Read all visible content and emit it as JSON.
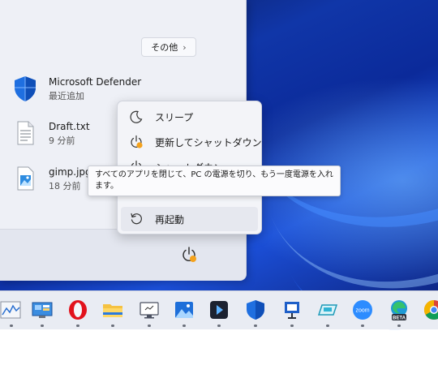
{
  "start_menu": {
    "more_label": "その他",
    "more_chevron": "›",
    "recommended": [
      {
        "name": "Microsoft Defender",
        "detail": "最近追加",
        "icon": "defender-shield-icon"
      },
      {
        "name": "Draft.txt",
        "detail": "9 分前",
        "icon": "text-file-icon"
      },
      {
        "name": "gimp.jpg",
        "detail": "18 分前",
        "icon": "image-file-icon"
      }
    ],
    "power_icon": "power-icon"
  },
  "power_menu": {
    "items": [
      {
        "label": "スリープ",
        "icon": "moon-icon"
      },
      {
        "label": "更新してシャットダウン",
        "icon": "update-shutdown-icon"
      },
      {
        "label": "シャットダウン",
        "icon": "power-icon"
      },
      {
        "label": "再起動",
        "icon": "restart-icon"
      }
    ]
  },
  "tooltip": {
    "text": "すべてのアプリを閉じて、PC の電源を切り、もう一度電源を入れます。"
  },
  "taskbar": {
    "apps": [
      {
        "name": "chart-app-icon"
      },
      {
        "name": "control-panel-icon"
      },
      {
        "name": "opera-browser-icon"
      },
      {
        "name": "file-explorer-icon"
      },
      {
        "name": "monitor-app-icon"
      },
      {
        "name": "photos-app-icon"
      },
      {
        "name": "media-app-icon"
      },
      {
        "name": "defender-app-icon"
      },
      {
        "name": "presentation-app-icon"
      },
      {
        "name": "remote-app-icon"
      },
      {
        "name": "zoom-app-icon",
        "label": "zoom"
      },
      {
        "name": "edge-beta-icon",
        "label": "BETA"
      },
      {
        "name": "chrome-icon"
      }
    ]
  },
  "colors": {
    "accent": "#0a5bd6",
    "update_badge": "#f4a21c"
  }
}
